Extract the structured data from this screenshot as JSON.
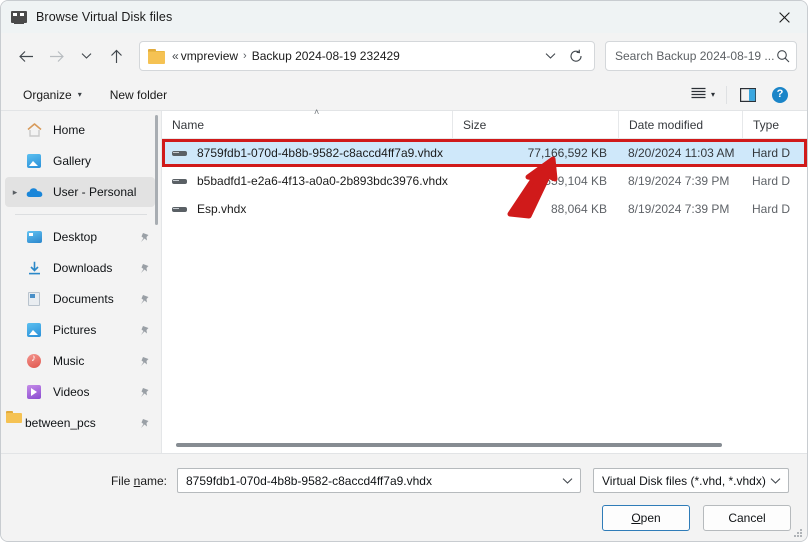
{
  "window": {
    "title": "Browse Virtual Disk files",
    "title_icon": "virtual-disk-icon",
    "close_label": "✕"
  },
  "nav": {
    "back": "back-arrow-icon",
    "forward": "forward-arrow-icon",
    "recent": "chevron-down-icon",
    "up": "up-arrow-icon",
    "breadcrumb": {
      "overflow": "«",
      "items": [
        "vmpreview",
        "Backup 2024-08-19 232429"
      ],
      "separator": "›"
    },
    "refresh_icon": "refresh-icon",
    "address_caret_icon": "chevron-down-icon"
  },
  "search": {
    "placeholder": "Search Backup 2024-08-19 ...",
    "icon": "search-icon"
  },
  "toolbar": {
    "organize_label": "Organize",
    "organize_caret": "▾",
    "new_folder_label": "New folder",
    "view_icon": "list-view-icon",
    "view_caret": "▾",
    "preview_pane_icon": "preview-pane-icon",
    "help_icon": "help-icon",
    "help_glyph": "?"
  },
  "sidebar": {
    "items": [
      {
        "label": "Home",
        "icon": "home-icon",
        "expandable": false,
        "pinned": false,
        "selected": false
      },
      {
        "label": "Gallery",
        "icon": "gallery-icon",
        "expandable": false,
        "pinned": false,
        "selected": false
      },
      {
        "label": "User - Personal",
        "icon": "onedrive-cloud-icon",
        "expandable": true,
        "pinned": false,
        "selected": true
      },
      {
        "separator": true
      },
      {
        "label": "Desktop",
        "icon": "desktop-icon",
        "expandable": false,
        "pinned": true,
        "selected": false
      },
      {
        "label": "Downloads",
        "icon": "downloads-icon",
        "expandable": false,
        "pinned": true,
        "selected": false
      },
      {
        "label": "Documents",
        "icon": "documents-icon",
        "expandable": false,
        "pinned": true,
        "selected": false
      },
      {
        "label": "Pictures",
        "icon": "pictures-icon",
        "expandable": false,
        "pinned": true,
        "selected": false
      },
      {
        "label": "Music",
        "icon": "music-icon",
        "expandable": false,
        "pinned": true,
        "selected": false
      },
      {
        "label": "Videos",
        "icon": "videos-icon",
        "expandable": false,
        "pinned": true,
        "selected": false
      },
      {
        "label": "between_pcs",
        "icon": "folder-icon",
        "expandable": false,
        "pinned": true,
        "selected": false
      }
    ]
  },
  "filelist": {
    "columns": [
      "Name",
      "Size",
      "Date modified",
      "Type"
    ],
    "sort_indicator": "˄",
    "rows": [
      {
        "name": "8759fdb1-070d-4b8b-9582-c8accd4ff7a9.vhdx",
        "size": "77,166,592 KB",
        "date": "8/20/2024 11:03 AM",
        "type": "Hard D",
        "icon": "hard-disk-icon",
        "selected": true,
        "highlighted": true
      },
      {
        "name": "b5badfd1-e2a6-4f13-a0a0-2b893bdc3976.vhdx",
        "size": "559,104 KB",
        "date": "8/19/2024 7:39 PM",
        "type": "Hard D",
        "icon": "hard-disk-icon",
        "selected": false,
        "highlighted": false
      },
      {
        "name": "Esp.vhdx",
        "size": "88,064 KB",
        "date": "8/19/2024 7:39 PM",
        "type": "Hard D",
        "icon": "hard-disk-icon",
        "selected": false,
        "highlighted": false
      }
    ]
  },
  "footer": {
    "filename_label_pre": "File ",
    "filename_label_accel": "n",
    "filename_label_post": "ame:",
    "filename_value": "8759fdb1-070d-4b8b-9582-c8accd4ff7a9.vhdx",
    "filter_value": "Virtual Disk files (*.vhd, *.vhdx)",
    "open_accel": "O",
    "open_rest": "pen",
    "cancel_label": "Cancel"
  },
  "annotation": {
    "color": "#d01a1a",
    "shapes": [
      "highlight-box-on-selected-row",
      "arrow-pointing-to-size-cell"
    ]
  }
}
